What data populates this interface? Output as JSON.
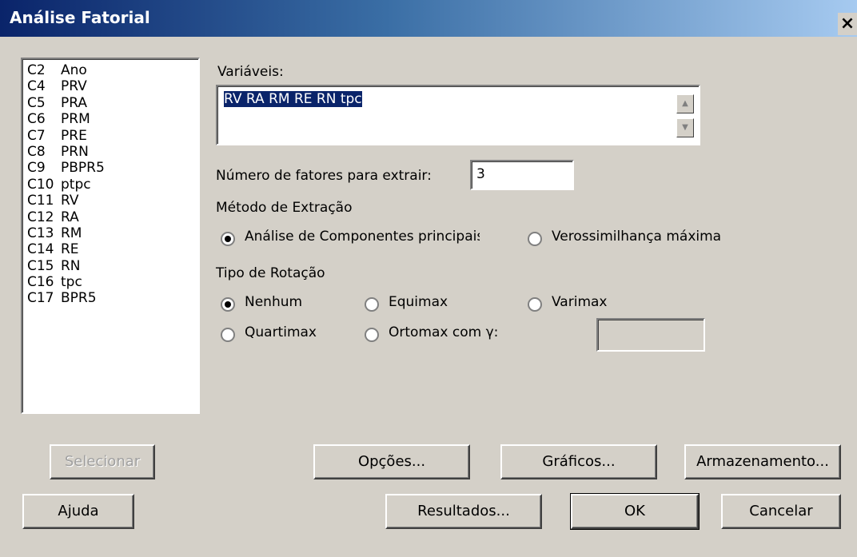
{
  "window": {
    "title": "Análise Fatorial",
    "close_glyph": "×"
  },
  "columns": [
    {
      "id": "C2",
      "name": "Ano"
    },
    {
      "id": "C4",
      "name": "PRV"
    },
    {
      "id": "C5",
      "name": "PRA"
    },
    {
      "id": "C6",
      "name": "PRM"
    },
    {
      "id": "C7",
      "name": "PRE"
    },
    {
      "id": "C8",
      "name": "PRN"
    },
    {
      "id": "C9",
      "name": "PBPR5"
    },
    {
      "id": "C10",
      "name": "ptpc"
    },
    {
      "id": "C11",
      "name": "RV"
    },
    {
      "id": "C12",
      "name": "RA"
    },
    {
      "id": "C13",
      "name": "RM"
    },
    {
      "id": "C14",
      "name": "RE"
    },
    {
      "id": "C15",
      "name": "RN"
    },
    {
      "id": "C16",
      "name": "tpc"
    },
    {
      "id": "C17",
      "name": "BPR5"
    }
  ],
  "variables": {
    "label": "Variáveis:",
    "value": "RV RA RM RE RN tpc"
  },
  "factors": {
    "label": "Número de fatores para extrair:",
    "value": "3"
  },
  "extraction": {
    "label": "Método de Extração",
    "options": [
      "Análise de Componentes principais",
      "Verossimilhança máxima"
    ],
    "selected": "Análise de Componentes principais"
  },
  "rotation": {
    "label": "Tipo de Rotação",
    "options": [
      "Nenhum",
      "Equimax",
      "Varimax",
      "Quartimax",
      "Ortomax com γ:"
    ],
    "selected": "Nenhum",
    "gamma_value": ""
  },
  "buttons": {
    "select": "Selecionar",
    "help": "Ajuda",
    "options": "Opções...",
    "graphs": "Gráficos...",
    "storage": "Armazenamento...",
    "results": "Resultados...",
    "ok": "OK",
    "cancel": "Cancelar"
  }
}
